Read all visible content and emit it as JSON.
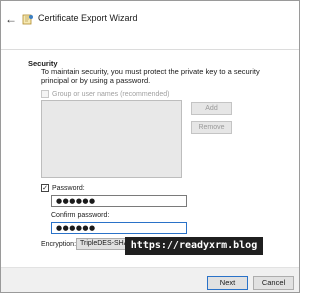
{
  "window": {
    "title": "Certificate Export Wizard",
    "back_icon": "back-arrow-icon",
    "wizard_icon": "certificate-wizard-icon"
  },
  "security": {
    "title": "Security",
    "description": "To maintain security, you must protect the private key to a security principal or by using a password.",
    "group_checkbox_label": "Group or user names (recommended)",
    "group_checked": false,
    "add_label": "Add",
    "remove_label": "Remove"
  },
  "password": {
    "checkbox_label": "Password:",
    "checked": true,
    "value": "●●●●●●",
    "confirm_label": "Confirm password:",
    "confirm_value": "●●●●●●"
  },
  "encryption": {
    "label": "Encryption:",
    "selected": "TripleDES-SHA1"
  },
  "watermark": {
    "text": "https://readyxrm.blog"
  },
  "footer": {
    "next_label": "Next",
    "cancel_label": "Cancel"
  },
  "colors": {
    "focus_border": "#2a72c8",
    "disabled_text": "#a0a0a0"
  }
}
